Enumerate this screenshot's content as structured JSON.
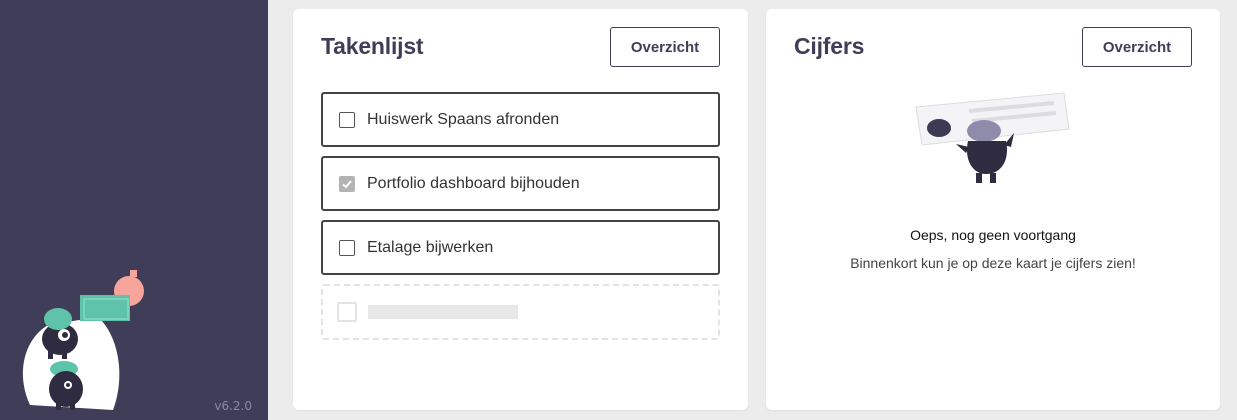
{
  "sidebar": {
    "version": "v6.2.0",
    "mascot_icon": "monsters-illustration"
  },
  "tasks_card": {
    "title": "Takenlijst",
    "overview_label": "Overzicht",
    "tasks": [
      {
        "label": "Huiswerk Spaans afronden",
        "checked": false
      },
      {
        "label": "Portfolio dashboard bijhouden",
        "checked": true
      },
      {
        "label": "Etalage bijwerken",
        "checked": false
      }
    ]
  },
  "grades_card": {
    "title": "Cijfers",
    "overview_label": "Overzicht",
    "empty_title": "Oeps, nog geen voortgang",
    "empty_text": "Binnenkort kun je op deze kaart je cijfers zien!",
    "illustration_icon": "monster-holding-card-illustration"
  },
  "colors": {
    "sidebar_bg": "#403d58",
    "accent": "#403d58",
    "mint": "#5fc3a9",
    "salmon": "#f7a49a"
  }
}
